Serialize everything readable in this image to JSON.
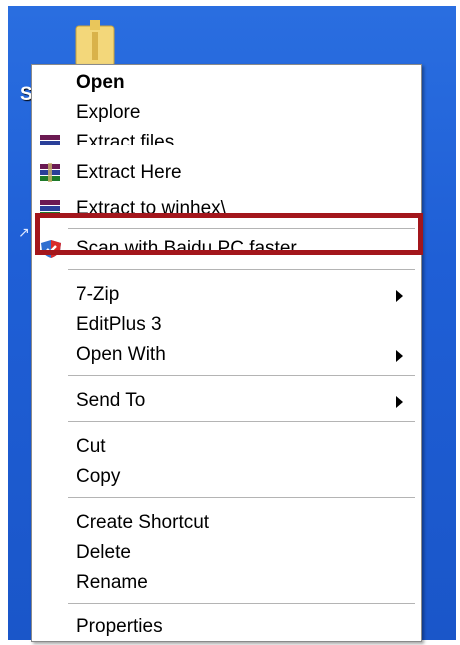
{
  "desktop": {
    "partial_label": "S",
    "partial_arrow": "↗"
  },
  "menu": {
    "items": {
      "open": "Open",
      "explore": "Explore",
      "extract_files": "Extract files...",
      "extract_here": "Extract Here",
      "extract_to": "Extract to winhex\\",
      "scan": "Scan with Baidu PC faster",
      "sevenzip": "7-Zip",
      "editplus": "EditPlus 3",
      "open_with": "Open With",
      "send_to": "Send To",
      "cut": "Cut",
      "copy": "Copy",
      "create_shortcut": "Create Shortcut",
      "delete": "Delete",
      "rename": "Rename",
      "properties": "Properties"
    }
  },
  "icons": {
    "winrar": "winrar-icon",
    "baidu": "baidu-shield-icon",
    "folder": "folder-icon",
    "submenu": "chevron-right-icon"
  },
  "colors": {
    "desktop_blue": "#1f5fd6",
    "highlight_red": "#a3161c",
    "menu_bg": "#ffffff"
  }
}
